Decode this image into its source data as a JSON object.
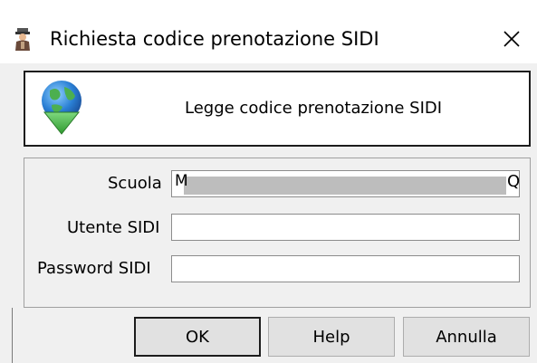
{
  "window": {
    "title": "Richiesta codice prenotazione SIDI",
    "close_glyph": "✕"
  },
  "header": {
    "text": "Legge codice prenotazione SIDI",
    "icon": "globe-download-icon"
  },
  "form": {
    "scuola": {
      "label": "Scuola",
      "value_start": "M",
      "value_end": "Q"
    },
    "utente": {
      "label": "Utente SIDI",
      "value": ""
    },
    "password": {
      "label": "Password SIDI",
      "value": ""
    }
  },
  "buttons": {
    "ok": "OK",
    "help": "Help",
    "cancel": "Annulla"
  },
  "colors": {
    "background": "#f0f0f0",
    "globe_blue": "#2a7fd4",
    "globe_green": "#3fae3f"
  }
}
